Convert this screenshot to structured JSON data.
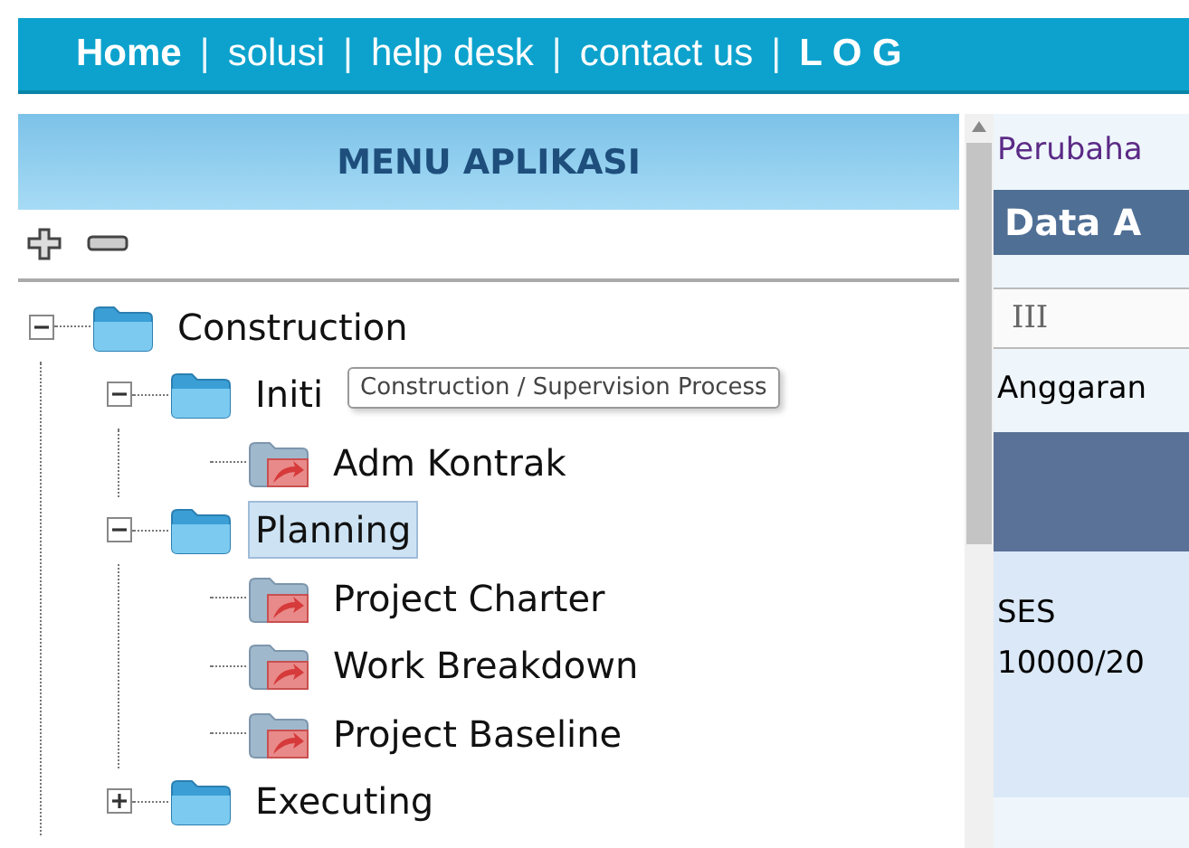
{
  "nav": {
    "separator": "|",
    "items": [
      {
        "label": "Home",
        "bold": true
      },
      {
        "label": "solusi",
        "bold": false
      },
      {
        "label": "help desk",
        "bold": false
      },
      {
        "label": "contact us",
        "bold": false
      },
      {
        "label": "L O G",
        "bold": true
      }
    ]
  },
  "menu": {
    "title": "MENU APLIKASI",
    "tree": [
      {
        "label": "Construction",
        "kind": "folder",
        "expanded": true,
        "selected": false,
        "children": [
          {
            "label": "Initi",
            "kind": "folder",
            "expanded": true,
            "selected": false,
            "children": [
              {
                "label": "Adm Kontrak",
                "kind": "page",
                "selected": false
              }
            ]
          },
          {
            "label": "Planning",
            "kind": "folder",
            "expanded": true,
            "selected": true,
            "children": [
              {
                "label": "Project Charter",
                "kind": "page",
                "selected": false
              },
              {
                "label": "Work Breakdown",
                "kind": "page",
                "selected": false
              },
              {
                "label": "Project Baseline",
                "kind": "page",
                "selected": false
              }
            ]
          },
          {
            "label": "Executing",
            "kind": "folder",
            "expanded": false,
            "selected": false
          }
        ]
      }
    ],
    "tooltip": "Construction / Supervision Process"
  },
  "content": {
    "link": "Perubaha",
    "heading": "Data A",
    "field_value": "III",
    "label": "Anggaran",
    "cell_1": "SES",
    "cell_2": "10000/20"
  }
}
